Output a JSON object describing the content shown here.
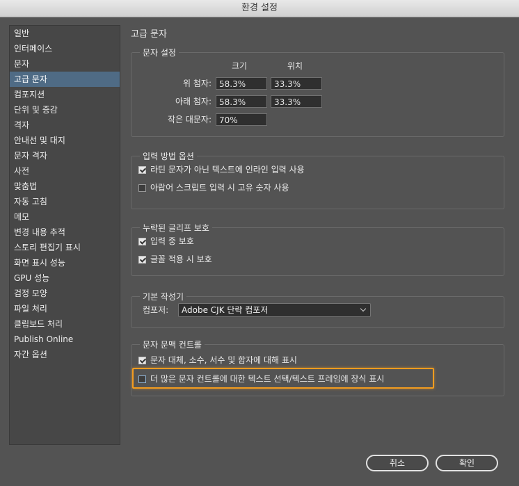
{
  "window": {
    "title": "환경 설정"
  },
  "sidebar": {
    "items": [
      {
        "label": "일반",
        "selected": false
      },
      {
        "label": "인터페이스",
        "selected": false
      },
      {
        "label": "문자",
        "selected": false
      },
      {
        "label": "고급 문자",
        "selected": true
      },
      {
        "label": "컴포지션",
        "selected": false
      },
      {
        "label": "단위 및 증감",
        "selected": false
      },
      {
        "label": "격자",
        "selected": false
      },
      {
        "label": "안내선 및 대지",
        "selected": false
      },
      {
        "label": "문자 격자",
        "selected": false
      },
      {
        "label": "사전",
        "selected": false
      },
      {
        "label": "맞춤법",
        "selected": false
      },
      {
        "label": "자동 고침",
        "selected": false
      },
      {
        "label": "메모",
        "selected": false
      },
      {
        "label": "변경 내용 추적",
        "selected": false
      },
      {
        "label": "스토리 편집기 표시",
        "selected": false
      },
      {
        "label": "화면 표시 성능",
        "selected": false
      },
      {
        "label": "GPU 성능",
        "selected": false
      },
      {
        "label": "검정 모양",
        "selected": false
      },
      {
        "label": "파일 처리",
        "selected": false
      },
      {
        "label": "클립보드 처리",
        "selected": false
      },
      {
        "label": "Publish Online",
        "selected": false
      },
      {
        "label": "자간 옵션",
        "selected": false
      }
    ]
  },
  "main": {
    "title": "고급 문자",
    "char_settings": {
      "legend": "문자 설정",
      "col_size": "크기",
      "col_position": "위치",
      "superscript_label": "위 첨자:",
      "superscript_size": "58.3%",
      "superscript_position": "33.3%",
      "subscript_label": "아래 첨자:",
      "subscript_size": "58.3%",
      "subscript_position": "33.3%",
      "smallcaps_label": "작은 대문자:",
      "smallcaps_size": "70%"
    },
    "input_options": {
      "legend": "입력 방법 옵션",
      "inline_input": {
        "label": "라틴 문자가 아닌 텍스트에 인라인 입력 사용",
        "checked": true
      },
      "arabic_digits": {
        "label": "아랍어 스크립트 입력 시 고유 숫자 사용",
        "checked": false
      }
    },
    "missing_glyph": {
      "legend": "누락된 글리프 보호",
      "protect_typing": {
        "label": "입력 중 보호",
        "checked": true
      },
      "protect_font": {
        "label": "글꼴 적용 시 보호",
        "checked": true
      }
    },
    "default_composer": {
      "legend": "기본 작성기",
      "label": "컴포저:",
      "value": "Adobe CJK 단락 컴포저"
    },
    "contextual_controls": {
      "legend": "문자 문맥 컨트롤",
      "show_alternates": {
        "label": "문자 대체, 소수, 서수 및 합자에 대해 표시",
        "checked": true
      },
      "show_more": {
        "label": "더 많은 문자 컨트롤에 대한 텍스트 선택/텍스트 프레임에 장식 표시",
        "checked": false
      }
    }
  },
  "buttons": {
    "cancel": "취소",
    "ok": "확인"
  },
  "colors": {
    "accent_selection": "#4f6b85",
    "highlight_border": "#f39c1f",
    "background": "#535353"
  }
}
